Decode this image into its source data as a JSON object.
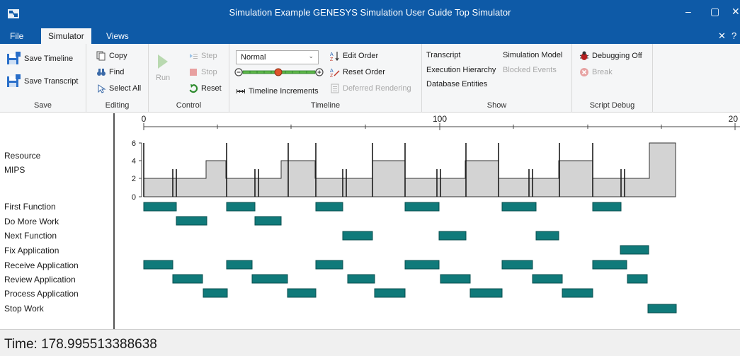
{
  "window": {
    "title": "Simulation Example GENESYS Simulation User Guide Top Simulator",
    "minimize": "–",
    "maximize": "▢",
    "close": "✕"
  },
  "tabs": {
    "file": "File",
    "simulator": "Simulator",
    "views": "Views"
  },
  "ribbon": {
    "save": {
      "label": "Save",
      "save_timeline": "Save Timeline",
      "save_transcript": "Save Transcript"
    },
    "editing": {
      "label": "Editing",
      "copy": "Copy",
      "find": "Find",
      "select_all": "Select All"
    },
    "control": {
      "label": "Control",
      "run": "Run",
      "step": "Step",
      "stop": "Stop",
      "reset": "Reset"
    },
    "timeline": {
      "label": "Timeline",
      "speed_value": "Normal",
      "timeline_increments": "Timeline Increments",
      "edit_order": "Edit Order",
      "reset_order": "Reset Order",
      "deferred_rendering": "Deferred Rendering"
    },
    "show": {
      "label": "Show",
      "transcript": "Transcript",
      "execution_hierarchy": "Execution Hierarchy",
      "database_entities": "Database Entities",
      "simulation_model": "Simulation Model",
      "blocked_events": "Blocked Events"
    },
    "script_debug": {
      "label": "Script Debug",
      "debugging_off": "Debugging Off",
      "break": "Break"
    }
  },
  "rows": {
    "resource": "Resource",
    "mips": "MIPS",
    "first_function": "First Function",
    "do_more_work": "Do More Work",
    "next_function": "Next Function",
    "fix_application": "Fix Application",
    "receive_application": "Receive Application",
    "review_application": "Review Application",
    "process_application": "Process Application",
    "stop_work": "Stop Work"
  },
  "status": {
    "time": "Time: 178.995513388638"
  },
  "colors": {
    "accent": "#0e5aa7",
    "bar": "#107a7a",
    "resource_fill": "#d3d3d3"
  },
  "chart_data": {
    "type": "gantt",
    "axis": {
      "ticks": [
        "0",
        "100",
        "20"
      ]
    },
    "resource_axis": {
      "ticks": [
        "6",
        "4",
        "2",
        "0"
      ]
    }
  }
}
